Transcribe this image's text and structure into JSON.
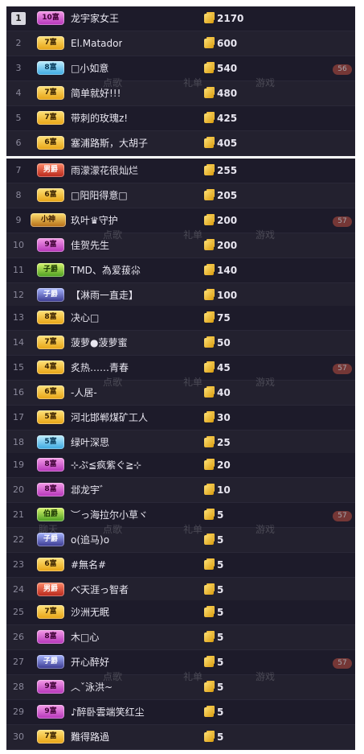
{
  "panels": [
    {
      "rows": [
        {
          "rank": "1",
          "level": "10富",
          "color": "pink",
          "name": "龙宇家女王",
          "score": "2170"
        },
        {
          "rank": "2",
          "level": "7富",
          "color": "gold",
          "name": "El.Matador",
          "score": "600"
        },
        {
          "rank": "3",
          "level": "8富",
          "color": "blue",
          "name": "□小如意",
          "score": "540"
        },
        {
          "rank": "4",
          "level": "7富",
          "color": "gold",
          "name": "简单就好!!!",
          "score": "480"
        },
        {
          "rank": "5",
          "level": "7富",
          "color": "gold",
          "name": "带刺的玫瑰z!",
          "score": "425"
        },
        {
          "rank": "6",
          "level": "6富",
          "color": "gold",
          "name": "塞浦路斯，大胡子",
          "score": "405"
        }
      ],
      "ghosts": [
        "点歌",
        "礼单",
        "游戏"
      ],
      "pill": "56"
    },
    {
      "rows": [
        {
          "rank": "7",
          "level": "男爵",
          "color": "red",
          "name": "雨濛濛花很灿烂",
          "score": "255"
        },
        {
          "rank": "8",
          "level": "6富",
          "color": "gold",
          "name": "□阳阳得意□",
          "score": "205"
        },
        {
          "rank": "9",
          "level": "小神",
          "color": "mech",
          "name": "玖叶♛守护",
          "score": "200"
        },
        {
          "rank": "10",
          "level": "9富",
          "color": "pink",
          "name": "佳贺先生",
          "score": "200"
        },
        {
          "rank": "11",
          "level": "子爵",
          "color": "green",
          "name": "TMD、為爱菝尛",
          "score": "140"
        },
        {
          "rank": "12",
          "level": "子爵",
          "color": "purple",
          "name": "【淋雨一直走】",
          "score": "100"
        }
      ],
      "ghosts": [
        "点歌",
        "礼单",
        "游戏"
      ],
      "pill": "57"
    },
    {
      "rows": [
        {
          "rank": "13",
          "level": "8富",
          "color": "gold",
          "name": "决心□",
          "score": "75"
        },
        {
          "rank": "14",
          "level": "7富",
          "color": "gold",
          "name": "菠萝●菠萝蜜",
          "score": "50"
        },
        {
          "rank": "15",
          "level": "4富",
          "color": "gold",
          "name": "炙热……青春",
          "score": "45"
        },
        {
          "rank": "16",
          "level": "6富",
          "color": "gold",
          "name": "-人居-",
          "score": "40"
        },
        {
          "rank": "17",
          "level": "5富",
          "color": "gold",
          "name": "河北邯郸煤矿工人",
          "score": "30"
        },
        {
          "rank": "18",
          "level": "5富",
          "color": "blue",
          "name": "绿叶深思",
          "score": "25"
        }
      ],
      "ghosts": [
        "点歌",
        "礼单",
        "游戏"
      ],
      "pill": "57"
    },
    {
      "rows": [
        {
          "rank": "19",
          "level": "8富",
          "color": "pink",
          "name": "⊹ぷ≦疯紫ぐ≧⊹",
          "score": "20"
        },
        {
          "rank": "20",
          "level": "8富",
          "color": "pink",
          "name": "邶龙宇゛",
          "score": "10"
        },
        {
          "rank": "21",
          "level": "伯爵",
          "color": "green",
          "name": "︶っ海拉尔小草ヾ",
          "score": "5"
        },
        {
          "rank": "22",
          "level": "子爵",
          "color": "purple",
          "name": "o(追马)o",
          "score": "5"
        },
        {
          "rank": "23",
          "level": "6富",
          "color": "gold",
          "name": "#無名#",
          "score": "5"
        },
        {
          "rank": "24",
          "level": "男爵",
          "color": "red",
          "name": "べ天涯っ智者",
          "score": "5"
        }
      ],
      "ghosts": [
        "聊天",
        "点歌",
        "礼单",
        "游戏"
      ],
      "pill": "57"
    },
    {
      "rows": [
        {
          "rank": "25",
          "level": "7富",
          "color": "gold",
          "name": "沙洲无眠",
          "score": "5"
        },
        {
          "rank": "26",
          "level": "8富",
          "color": "pink",
          "name": "木□心",
          "score": "5"
        },
        {
          "rank": "27",
          "level": "子爵",
          "color": "purple",
          "name": "开心醉好",
          "score": "5"
        },
        {
          "rank": "28",
          "level": "9富",
          "color": "pink",
          "name": "︿ˇ泳洪~",
          "score": "5"
        },
        {
          "rank": "29",
          "level": "9富",
          "color": "pink",
          "name": "♪醉卧雲端笑红尘",
          "score": "5"
        },
        {
          "rank": "30",
          "level": "7富",
          "color": "gold",
          "name": "難得路過",
          "score": "5"
        }
      ],
      "ghosts": [
        "点歌",
        "礼单",
        "游戏"
      ],
      "pill": "57"
    }
  ]
}
